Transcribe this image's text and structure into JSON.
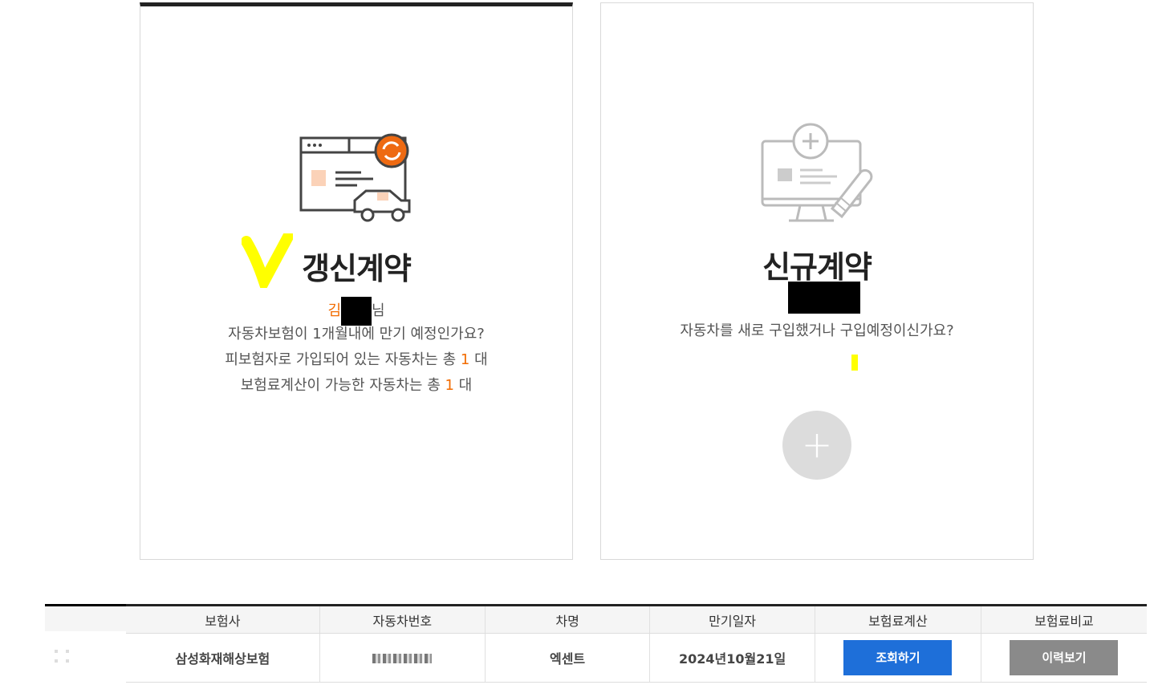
{
  "renew_card": {
    "title": "갱신계약",
    "name_prefix": "김",
    "name_suffix": "님",
    "line1": "자동차보험이 1개월내에 만기 예정인가요?",
    "line2_pre": "피보험자로 가입되어 있는 자동차는 총 ",
    "line2_count": "1",
    "line2_post": " 대",
    "line3_pre": "보험료계산이 가능한 자동차는 총 ",
    "line3_count": "1",
    "line3_post": " 대",
    "accent_color": "#f26b00"
  },
  "new_card": {
    "title": "신규계약",
    "line1": "자동차를 새로 구입했거나 구입예정이신가요?",
    "add_label": "+"
  },
  "table": {
    "headers": [
      "보험사",
      "자동차번호",
      "차명",
      "만기일자",
      "보험료계산",
      "보험료비교"
    ],
    "row": {
      "insurer": "삼성화재해상보험",
      "car_name": "엑센트",
      "expiry": "2024년10월21일",
      "calc_button": "조회하기",
      "compare_button": "이력보기"
    }
  },
  "icons": [
    "renew-contract-icon",
    "new-contract-icon",
    "add-icon"
  ]
}
